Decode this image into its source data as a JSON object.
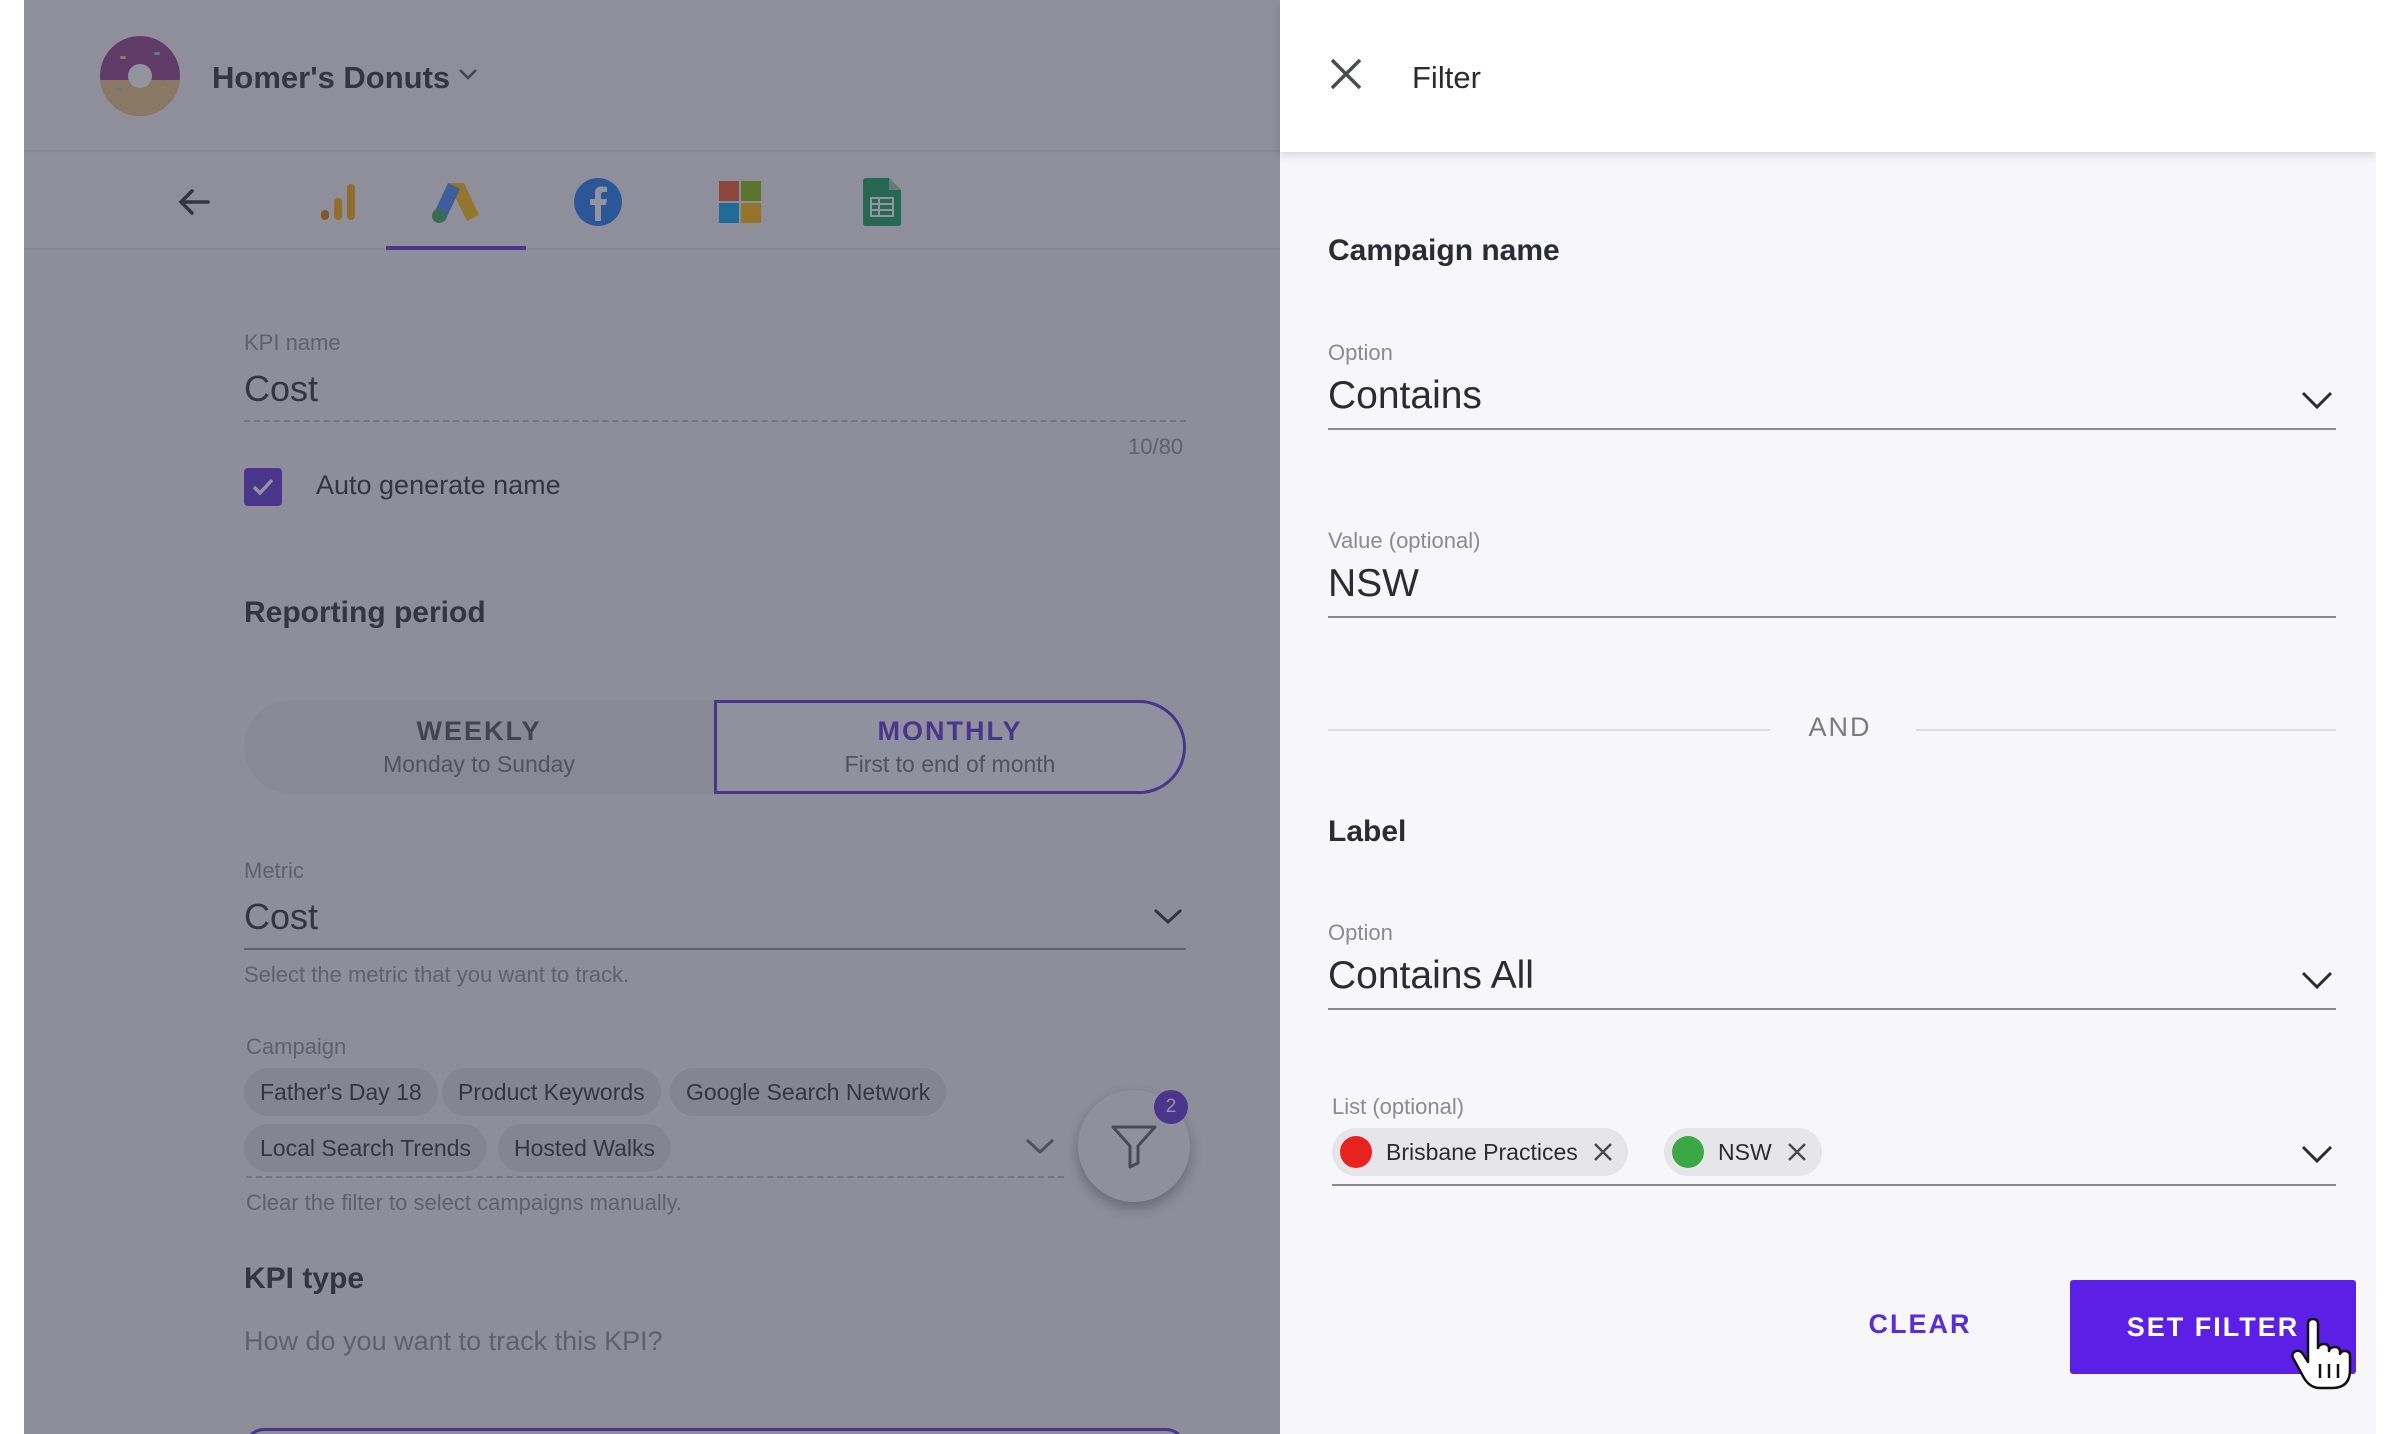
{
  "header": {
    "brand_name": "Homer's Donuts"
  },
  "kpi_form": {
    "kpi_name": {
      "label": "KPI name",
      "value": "Cost",
      "counter": "10/80"
    },
    "auto_generate": {
      "label": "Auto generate name",
      "checked": true
    },
    "reporting_period": {
      "title": "Reporting period",
      "weekly": {
        "label": "WEEKLY",
        "sub": "Monday to Sunday"
      },
      "monthly": {
        "label": "MONTHLY",
        "sub": "First to end of month",
        "selected": true
      }
    },
    "metric": {
      "label": "Metric",
      "value": "Cost",
      "helper": "Select the metric that you want to track."
    },
    "campaign": {
      "label": "Campaign",
      "chips": [
        "Father's Day 18",
        "Product Keywords",
        "Google Search Network",
        "Local Search Trends",
        "Hosted Walks"
      ],
      "helper": "Clear the filter to select campaigns manually.",
      "filter_badge": "2"
    },
    "kpi_type": {
      "title": "KPI type",
      "question": "How do you want to track this KPI?"
    }
  },
  "filter_panel": {
    "title": "Filter",
    "campaign_name": {
      "title": "Campaign name",
      "option_label": "Option",
      "option_value": "Contains",
      "value_label": "Value (optional)",
      "value": "NSW"
    },
    "joiner": "AND",
    "label": {
      "title": "Label",
      "option_label": "Option",
      "option_value": "Contains All",
      "list_label": "List (optional)",
      "tags": [
        {
          "text": "Brisbane Practices",
          "color": "#e8221f"
        },
        {
          "text": "NSW",
          "color": "#3ba846"
        }
      ]
    },
    "buttons": {
      "clear": "CLEAR",
      "set": "SET FILTER"
    }
  },
  "colors": {
    "accent": "#5b2dd8",
    "button": "#5b1fe6"
  }
}
